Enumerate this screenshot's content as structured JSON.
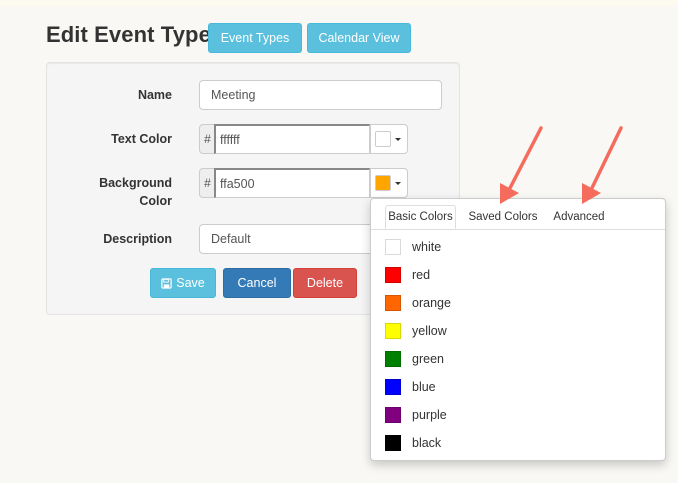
{
  "page": {
    "title": "Edit Event Type"
  },
  "nav": {
    "event_types": "Event Types",
    "calendar_view": "Calendar View"
  },
  "form": {
    "name_label": "Name",
    "name_value": "Meeting",
    "text_color_label": "Text Color",
    "text_color_hash": "#",
    "text_color_value": "ffffff",
    "text_color_swatch": "#ffffff",
    "bg_label_line1": "Background",
    "bg_label_line2": "Color",
    "bg_color_hash": "#",
    "bg_color_value": "ffa500",
    "bg_color_swatch": "#ffa500",
    "description_label": "Description",
    "description_value": "Default"
  },
  "actions": {
    "save": "Save",
    "cancel": "Cancel",
    "delete": "Delete"
  },
  "popup": {
    "tabs": [
      "Basic Colors",
      "Saved Colors",
      "Advanced"
    ],
    "active_tab": "Basic Colors",
    "colors": [
      {
        "name": "white",
        "hex": "#ffffff"
      },
      {
        "name": "red",
        "hex": "#ff0000"
      },
      {
        "name": "orange",
        "hex": "#ff6600"
      },
      {
        "name": "yellow",
        "hex": "#ffff00"
      },
      {
        "name": "green",
        "hex": "#008000"
      },
      {
        "name": "blue",
        "hex": "#0000ff"
      },
      {
        "name": "purple",
        "hex": "#800080"
      },
      {
        "name": "black",
        "hex": "#000000"
      }
    ]
  },
  "annotation_color": "#f56b5c"
}
